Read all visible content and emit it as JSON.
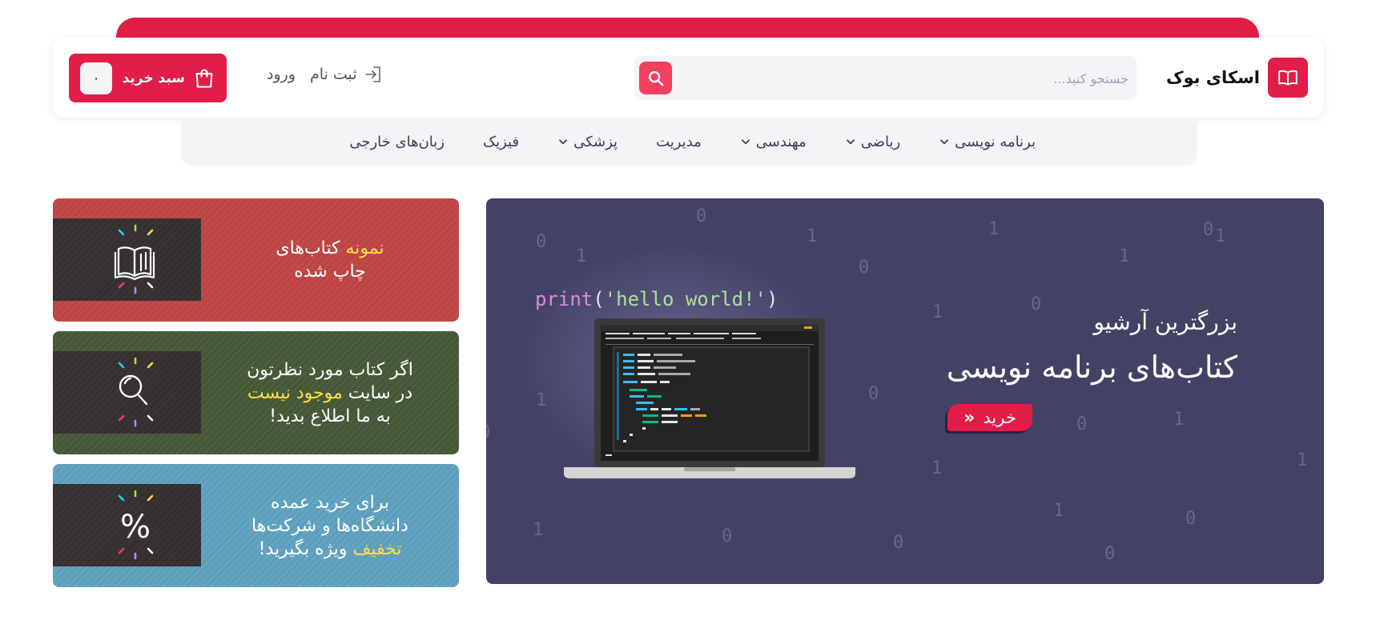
{
  "header": {
    "brand_name": "اسکای بوک",
    "search_placeholder": "جستجو کنید...",
    "register_label": "ثبت نام",
    "login_label": "ورود",
    "cart_label": "سبد خرید",
    "cart_count": "۰"
  },
  "nav": {
    "items": [
      {
        "label": "برنامه نویسی",
        "has_dropdown": true
      },
      {
        "label": "ریاضی",
        "has_dropdown": true
      },
      {
        "label": "مهندسی",
        "has_dropdown": true
      },
      {
        "label": "مدیریت",
        "has_dropdown": false
      },
      {
        "label": "پزشکی",
        "has_dropdown": true
      },
      {
        "label": "فیزیک",
        "has_dropdown": false
      },
      {
        "label": "زبان‌های خارجی",
        "has_dropdown": false
      }
    ]
  },
  "hero": {
    "subtitle": "بزرگترین آرشیو",
    "title": "کتاب‌های برنامه نویسی",
    "buy_label": "خرید",
    "code_fn": "print",
    "code_open": "(",
    "code_str": "'hello world!'",
    "code_close": ")"
  },
  "cards": [
    {
      "icon": "open-book-icon",
      "highlight": "نمونه",
      "line1_rest": " کتاب‌های",
      "line2": "چاپ شده"
    },
    {
      "icon": "magnifier-icon",
      "line1": "اگر کتاب مورد نظرتون",
      "line2_pre": "در سایت ",
      "highlight": "موجود نیست",
      "line3": "به ما اطلاع بدید!"
    },
    {
      "icon": "percent-icon",
      "line1": "برای خرید عمده",
      "line2": "دانشگاه‌ها و شرکت‌ها",
      "highlight": "تخفیف",
      "line3_rest": " ویژه بگیرید!"
    }
  ],
  "colors": {
    "accent": "#e11d48",
    "hero_bg": "#444264",
    "card_red": "#c34a4a",
    "card_green": "#4b5f3c",
    "card_blue": "#64a5c3",
    "highlight": "#fde047"
  }
}
